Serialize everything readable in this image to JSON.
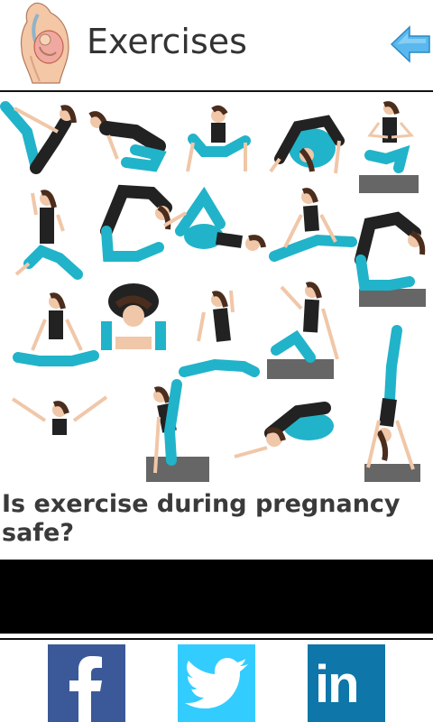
{
  "header": {
    "title": "Exercises",
    "logo_icon": "pregnancy-illustration-icon",
    "back_icon": "back-arrow-icon"
  },
  "content": {
    "image_icon": "yoga-poses-illustration",
    "heading": "Is exercise during pregnancy safe?"
  },
  "social": [
    {
      "name": "facebook",
      "icon": "facebook-icon",
      "color": "#3b5998"
    },
    {
      "name": "twitter",
      "icon": "twitter-icon",
      "color": "#33ccff"
    },
    {
      "name": "linkedin",
      "icon": "linkedin-icon",
      "color": "#0e76a8",
      "label": "in"
    }
  ],
  "colors": {
    "arrow": "#59b8ee",
    "divider": "#111111",
    "outfit_top": "#222222",
    "outfit_pants": "#21b3c9",
    "skin": "#f0c7a8",
    "hair": "#4a2d1d"
  }
}
